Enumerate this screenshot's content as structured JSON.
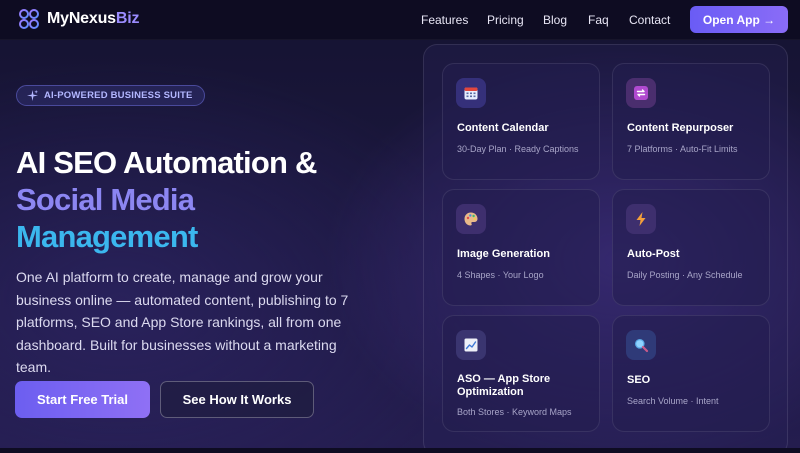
{
  "brand": {
    "name_part1": "MyNexus",
    "name_part2": "Biz"
  },
  "nav": {
    "links": [
      "Features",
      "Pricing",
      "Blog",
      "Faq",
      "Contact"
    ],
    "cta": "Open App →"
  },
  "hero": {
    "badge": "AI-POWERED BUSINESS SUITE",
    "headline_line1": "AI SEO Automation &",
    "headline_line2": "Social Media",
    "headline_line3": "Management",
    "description": "One AI platform to create, manage and grow your business online — automated content, publishing to 7 platforms, SEO and App Store rankings, all from one dashboard. Built for businesses without a marketing team.",
    "primary_cta": "Start Free Trial",
    "secondary_cta": "See How It Works"
  },
  "features": [
    {
      "title": "Content Calendar",
      "subtitle": "30-Day Plan · Ready Captions",
      "icon": "calendar-icon"
    },
    {
      "title": "Content Repurposer",
      "subtitle": "7 Platforms · Auto-Fit Limits",
      "icon": "repurpose-icon"
    },
    {
      "title": "Image Generation",
      "subtitle": "4 Shapes · Your Logo",
      "icon": "palette-icon"
    },
    {
      "title": "Auto-Post",
      "subtitle": "Daily Posting · Any Schedule",
      "icon": "lightning-icon"
    },
    {
      "title": "ASO — App Store Optimization",
      "subtitle": "Both Stores · Keyword Maps",
      "icon": "chart-icon"
    },
    {
      "title": "SEO",
      "subtitle": "Search Volume · Intent",
      "icon": "magnifier-icon"
    }
  ],
  "colors": {
    "accent": "#7a66f5",
    "headline_violet": "#8c86f2",
    "headline_cyan": "#3bb7ee",
    "background": "#1c1840"
  }
}
